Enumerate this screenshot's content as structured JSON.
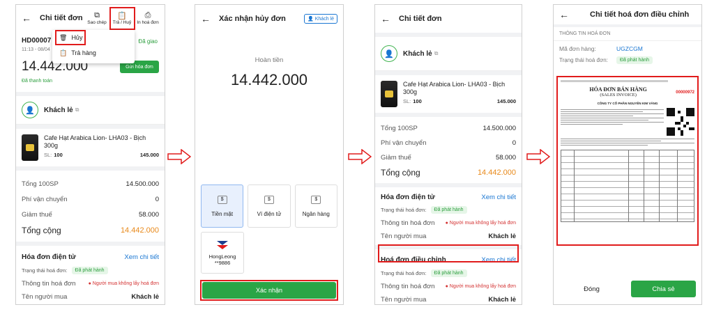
{
  "screen1": {
    "title": "Chi tiết đơn",
    "toolbar": {
      "copy": "Sao chép",
      "return": "Trả / Huỷ",
      "print": "In hoá đơn"
    },
    "dropdown": {
      "cancel": "Hủy",
      "return": "Trả hàng"
    },
    "order_code": "HD00007 -",
    "order_time": "11:13 - 08/04",
    "status": "Đã giao",
    "total": "14.442.000",
    "send_invoice": "Gửi hóa đơn",
    "paid": "Đã thanh toán",
    "customer": "Khách lẻ",
    "product_name": "Cafe Hạt Arabica Lion- LHA03 - Bịch 300g",
    "qty_label": "SL:",
    "qty": "100",
    "product_price": "145.000",
    "summary": [
      {
        "label": "Tổng 100SP",
        "value": "14.500.000"
      },
      {
        "label": "Phí vận chuyển",
        "value": "0"
      },
      {
        "label": "Giảm thuế",
        "value": "58.000"
      }
    ],
    "grand_label": "Tổng cộng",
    "grand_value": "14.442.000",
    "einvoice_title": "Hóa đơn điện tử",
    "view_detail": "Xem chi tiết",
    "invoice_status_label": "Trạng thái hoá đơn:",
    "invoice_status": "Đã phát hành",
    "invoice_info_label": "Thông tin hoá đơn",
    "invoice_info": "Người mua không lấy hoá đơn",
    "buyer_label": "Tên người mua",
    "buyer": "Khách lẻ"
  },
  "screen2": {
    "title": "Xác nhận hủy đơn",
    "customer_chip": "Khách lẻ",
    "refund_label": "Hoàn tiền",
    "refund_amount": "14.442.000",
    "methods": [
      "Tiền mặt",
      "Ví điện tử",
      "Ngân hàng"
    ],
    "bank_name": "HongLeong",
    "bank_acc": "**9886",
    "confirm": "Xác nhận"
  },
  "screen3": {
    "title": "Chi tiết đơn",
    "customer": "Khách lẻ",
    "product_name": "Cafe Hạt Arabica Lion- LHA03 - Bịch 300g",
    "qty_label": "SL:",
    "qty": "100",
    "product_price": "145.000",
    "summary": [
      {
        "label": "Tổng 100SP",
        "value": "14.500.000"
      },
      {
        "label": "Phí vận chuyển",
        "value": "0"
      },
      {
        "label": "Giảm thuế",
        "value": "58.000"
      }
    ],
    "grand_label": "Tổng cộng",
    "grand_value": "14.442.000",
    "einvoice_title": "Hóa đơn điện tử",
    "view_detail": "Xem chi tiết",
    "invoice_status_label": "Trạng thái hoá đơn:",
    "invoice_status": "Đã phát hành",
    "invoice_info_label": "Thông tin hoá đơn",
    "invoice_info": "Người mua không lấy hoá đơn",
    "buyer_label": "Tên người mua",
    "buyer": "Khách lẻ",
    "adjust_title": "Hoá đơn điều chỉnh",
    "adjust_status": "Đã phát hành",
    "adjust_buyer": "Khách lẻ"
  },
  "screen4": {
    "title": "Chi tiết hoá đơn điều chỉnh",
    "section": "THÔNG TIN HOÁ ĐƠN",
    "code_label": "Mã đơn hàng:",
    "code": "UGZCGM",
    "status_label": "Trạng thái hoá đơn:",
    "status": "Đã phát hành",
    "invoice_title": "HÓA ĐƠN BÁN HÀNG",
    "invoice_subtitle": "(SALES INVOICE)",
    "invoice_number": "00000972",
    "company": "CÔNG TY CỔ PHẦN NGUYỄN KIM VĂNG",
    "close": "Đóng",
    "share": "Chia sẻ"
  },
  "colors": {
    "green": "#2aa546",
    "orange": "#e8891a",
    "red": "#e11b1b",
    "blue": "#1976d2"
  }
}
